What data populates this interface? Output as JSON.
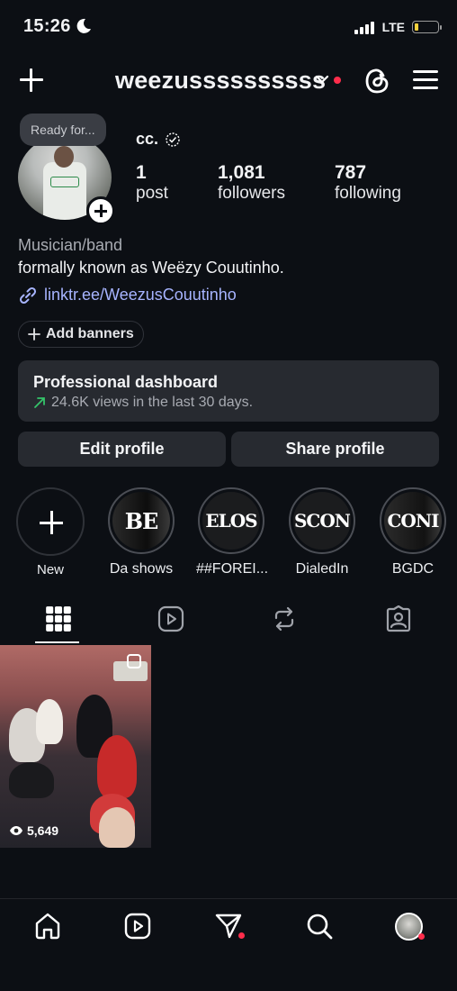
{
  "status_bar": {
    "time": "15:26",
    "network": "LTE",
    "battery_level": 0.15
  },
  "header": {
    "username": "weezussssssssss"
  },
  "profile": {
    "story_bubble": "Ready for...",
    "display_name": "cc.",
    "stats": [
      {
        "value": "1",
        "label": "post"
      },
      {
        "value": "1,081",
        "label": "followers"
      },
      {
        "value": "787",
        "label": "following"
      }
    ],
    "category": "Musician/band",
    "bio": "formally known as Weëzy Couutinho.",
    "link": "linktr.ee/WeezusCouutinho",
    "add_banners": "Add banners"
  },
  "dashboard": {
    "title": "Professional dashboard",
    "subtitle": "24.6K views in the last 30 days."
  },
  "buttons": {
    "edit": "Edit profile",
    "share": "Share profile"
  },
  "highlights": [
    {
      "label": "New",
      "cover": ""
    },
    {
      "label": "Da shows",
      "cover": "BE"
    },
    {
      "label": "##FOREI...",
      "cover": "ELOS"
    },
    {
      "label": "DialedIn",
      "cover": "SCON"
    },
    {
      "label": "BGDC",
      "cover": "CONI"
    }
  ],
  "tabs": [
    "grid-icon",
    "reels-icon",
    "reposts-icon",
    "tagged-icon"
  ],
  "posts": [
    {
      "views": "5,649"
    }
  ],
  "nav": [
    "home-icon",
    "reels-icon",
    "send-icon",
    "search-icon",
    "profile-avatar"
  ],
  "colors": {
    "background": "#0c0f14",
    "link": "#a7b4ff",
    "notification": "#ff2d4b",
    "trend": "#35c46a"
  }
}
